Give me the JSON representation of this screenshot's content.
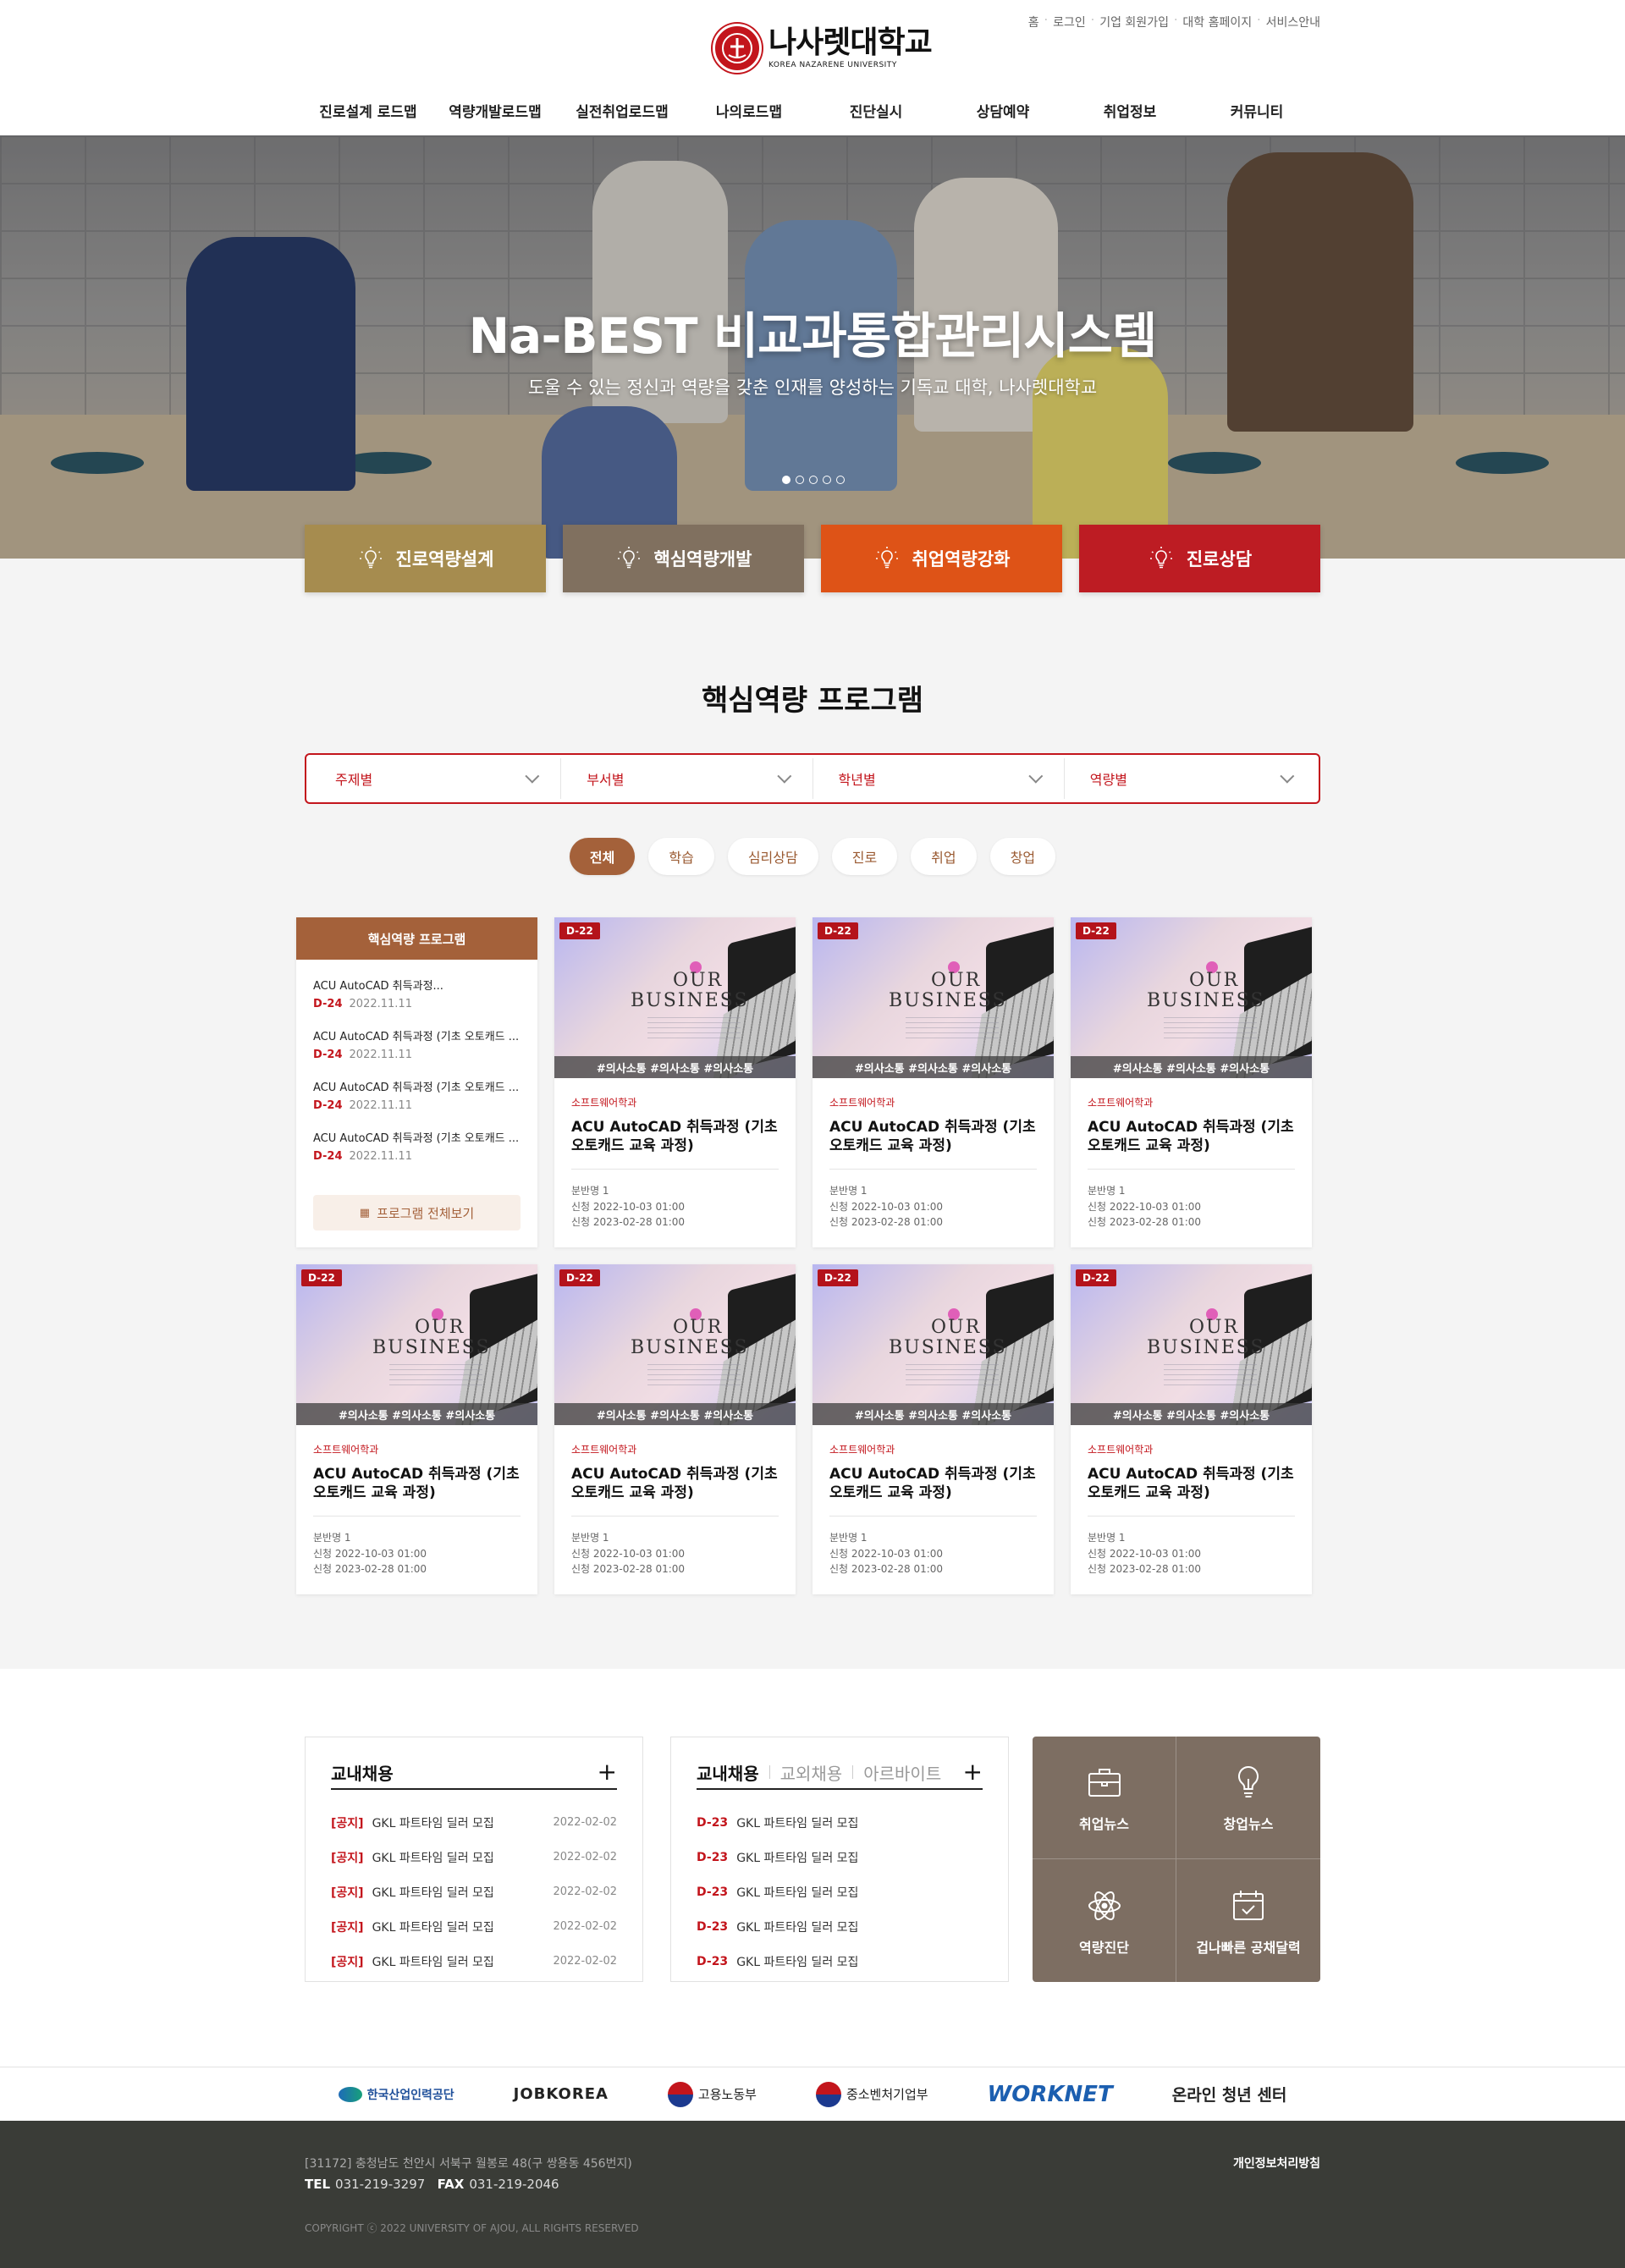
{
  "header": {
    "logo_ko": "나사렛대학교",
    "logo_en": "KOREA NAZARENE UNIVERSITY",
    "util": [
      "홈",
      "로그인",
      "기업 회원가입",
      "대학 홈페이지",
      "서비스안내"
    ],
    "gnb": [
      "진로설계 로드맵",
      "역량개발로드맵",
      "실전취업로드맵",
      "나의로드맵",
      "진단실시",
      "상담예약",
      "취업정보",
      "커뮤니티"
    ]
  },
  "hero": {
    "title": "Na-BEST 비교과통합관리시스템",
    "subtitle": "도울 수 있는 정신과 역량을 갖춘 인재를 양성하는 기독교 대학, 나사렛대학교"
  },
  "quick": [
    {
      "label": "진로역량설계",
      "color": "#a68c4f"
    },
    {
      "label": "핵심역량개발",
      "color": "#80705f"
    },
    {
      "label": "취업역량강화",
      "color": "#de5317"
    },
    {
      "label": "진로상담",
      "color": "#bd1c23"
    }
  ],
  "program": {
    "title": "핵심역량 프로그램",
    "filters": [
      "주제별",
      "부서별",
      "학년별",
      "역량별"
    ],
    "tabs": [
      "전체",
      "학습",
      "심리상담",
      "진로",
      "취업",
      "창업"
    ],
    "side": {
      "head": "핵심역량 프로그램",
      "items": [
        {
          "title": "ACU AutoCAD 취득과정...",
          "dday": "D-24",
          "date": "2022.11.11"
        },
        {
          "title": "ACU AutoCAD 취득과정 (기초 오토캐드 ...",
          "dday": "D-24",
          "date": "2022.11.11"
        },
        {
          "title": "ACU AutoCAD 취득과정 (기초 오토캐드 ...",
          "dday": "D-24",
          "date": "2022.11.11"
        },
        {
          "title": "ACU AutoCAD 취득과정 (기초 오토캐드 ...",
          "dday": "D-24",
          "date": "2022.11.11"
        }
      ],
      "more": "프로그램 전체보기"
    },
    "cards": [
      {
        "dday": "D-22",
        "tags": "#의사소통 #의사소통 #의사소통",
        "dept": "소프트웨어학과",
        "title": "ACU AutoCAD 취득과정 (기초 오토캐드 교육 과정)",
        "class": "분반명  1",
        "apply": "신청  2022-10-03 01:00",
        "end": "신청  2023-02-28 01:00"
      },
      {
        "dday": "D-22",
        "tags": "#의사소통 #의사소통 #의사소통",
        "dept": "소프트웨어학과",
        "title": "ACU AutoCAD 취득과정 (기초 오토캐드 교육 과정)",
        "class": "분반명  1",
        "apply": "신청  2022-10-03 01:00",
        "end": "신청  2023-02-28 01:00"
      },
      {
        "dday": "D-22",
        "tags": "#의사소통 #의사소통 #의사소통",
        "dept": "소프트웨어학과",
        "title": "ACU AutoCAD 취득과정 (기초 오토캐드 교육 과정)",
        "class": "분반명  1",
        "apply": "신청  2022-10-03 01:00",
        "end": "신청  2023-02-28 01:00"
      },
      {
        "dday": "D-22",
        "tags": "#의사소통 #의사소통 #의사소통",
        "dept": "소프트웨어학과",
        "title": "ACU AutoCAD 취득과정 (기초 오토캐드 교육 과정)",
        "class": "분반명  1",
        "apply": "신청  2022-10-03 01:00",
        "end": "신청  2023-02-28 01:00"
      },
      {
        "dday": "D-22",
        "tags": "#의사소통 #의사소통 #의사소통",
        "dept": "소프트웨어학과",
        "title": "ACU AutoCAD 취득과정 (기초 오토캐드 교육 과정)",
        "class": "분반명  1",
        "apply": "신청  2022-10-03 01:00",
        "end": "신청  2023-02-28 01:00"
      },
      {
        "dday": "D-22",
        "tags": "#의사소통 #의사소통 #의사소통",
        "dept": "소프트웨어학과",
        "title": "ACU AutoCAD 취득과정 (기초 오토캐드 교육 과정)",
        "class": "분반명  1",
        "apply": "신청  2022-10-03 01:00",
        "end": "신청  2023-02-28 01:00"
      },
      {
        "dday": "D-22",
        "tags": "#의사소통 #의사소통 #의사소통",
        "dept": "소프트웨어학과",
        "title": "ACU AutoCAD 취득과정 (기초 오토캐드 교육 과정)",
        "class": "분반명  1",
        "apply": "신청  2022-10-03 01:00",
        "end": "신청  2023-02-28 01:00"
      }
    ],
    "thumb_text1": "OUR",
    "thumb_text2": "BUSINESS"
  },
  "recruit": {
    "box1": {
      "title": "교내채용",
      "items": [
        {
          "label": "[공지]",
          "text": "GKL 파트타임 딜러 모집",
          "date": "2022-02-02"
        },
        {
          "label": "[공지]",
          "text": "GKL 파트타임 딜러 모집",
          "date": "2022-02-02"
        },
        {
          "label": "[공지]",
          "text": "GKL 파트타임 딜러 모집",
          "date": "2022-02-02"
        },
        {
          "label": "[공지]",
          "text": "GKL 파트타임 딜러 모집",
          "date": "2022-02-02"
        },
        {
          "label": "[공지]",
          "text": "GKL 파트타임 딜러 모집",
          "date": "2022-02-02"
        }
      ]
    },
    "box2": {
      "tabs": [
        "교내채용",
        "교외채용",
        "아르바이트"
      ],
      "items": [
        {
          "label": "D-23",
          "text": "GKL 파트타임 딜러 모집"
        },
        {
          "label": "D-23",
          "text": "GKL 파트타임 딜러 모집"
        },
        {
          "label": "D-23",
          "text": "GKL 파트타임 딜러 모집"
        },
        {
          "label": "D-23",
          "text": "GKL 파트타임 딜러 모집"
        },
        {
          "label": "D-23",
          "text": "GKL 파트타임 딜러 모집"
        }
      ]
    },
    "quicklinks": [
      {
        "label": "취업뉴스",
        "icon": "briefcase-icon"
      },
      {
        "label": "창업뉴스",
        "icon": "lightbulb-icon"
      },
      {
        "label": "역량진단",
        "icon": "atom-icon"
      },
      {
        "label": "겁나빠른 공채달력",
        "icon": "calendar-check-icon"
      }
    ]
  },
  "partners": [
    "한국산업인력공단",
    "JOBKOREA",
    "고용노동부",
    "중소벤처기업부",
    "WORKNET",
    "온라인 청년 센터"
  ],
  "footer": {
    "address": "[31172] 충청남도 천안시 서북구 월봉로 48(구 쌍용동 456번지)",
    "tel_label": "TEL",
    "tel": "031-219-3297",
    "fax_label": "FAX",
    "fax": "031-219-2046",
    "copyright": "COPYRIGHT ⓒ 2022 UNIVERSITY OF AJOU, ALL RIGHTS RESERVED",
    "privacy": "개인정보처리방침"
  }
}
